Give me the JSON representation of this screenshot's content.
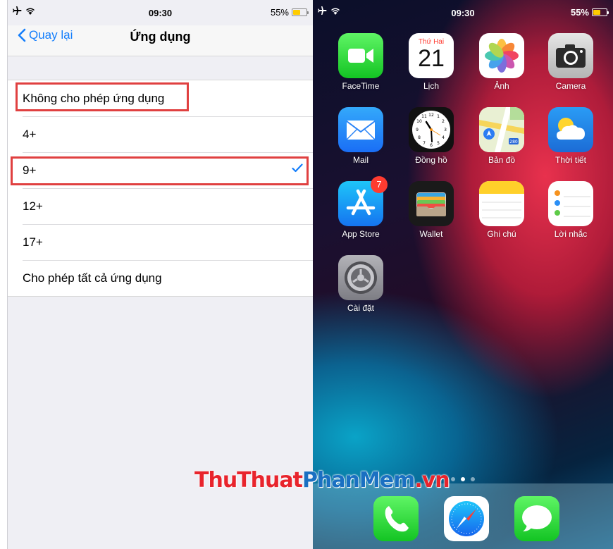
{
  "left": {
    "status": {
      "time": "09:30",
      "battery": "55%"
    },
    "nav": {
      "back_label": "Quay lại",
      "title": "Ứng dụng"
    },
    "options": [
      {
        "label": "Không cho phép ứng dụng"
      },
      {
        "label": "4+"
      },
      {
        "label": "9+",
        "checked": true
      },
      {
        "label": "12+"
      },
      {
        "label": "17+"
      },
      {
        "label": "Cho phép tất cả ứng dụng"
      }
    ]
  },
  "right": {
    "status": {
      "time": "09:30",
      "battery": "55%"
    },
    "calendar": {
      "day_name": "Thứ Hai",
      "day_number": "21"
    },
    "apps": [
      {
        "name": "FaceTime",
        "icon": "facetime-icon"
      },
      {
        "name": "Lịch",
        "icon": "calendar-icon"
      },
      {
        "name": "Ảnh",
        "icon": "photos-icon"
      },
      {
        "name": "Camera",
        "icon": "camera-icon"
      },
      {
        "name": "Mail",
        "icon": "mail-icon"
      },
      {
        "name": "Đồng hồ",
        "icon": "clock-icon"
      },
      {
        "name": "Bản đồ",
        "icon": "maps-icon"
      },
      {
        "name": "Thời tiết",
        "icon": "weather-icon"
      },
      {
        "name": "App Store",
        "icon": "app-store-icon",
        "badge": "7"
      },
      {
        "name": "Wallet",
        "icon": "wallet-icon"
      },
      {
        "name": "Ghi chú",
        "icon": "notes-icon"
      },
      {
        "name": "Lời nhắc",
        "icon": "reminders-icon"
      },
      {
        "name": "Cài đặt",
        "icon": "settings-icon"
      }
    ],
    "maps_shield": "280",
    "dock": [
      {
        "icon": "phone-icon"
      },
      {
        "icon": "safari-icon"
      },
      {
        "icon": "messages-icon"
      }
    ]
  },
  "watermark": {
    "part1": "ThuThuat",
    "part2": "PhanMem",
    "part3": ".vn"
  },
  "colors": {
    "ios_blue": "#147efb",
    "highlight_red": "#e04040",
    "battery_yellow": "#ffcc00"
  }
}
